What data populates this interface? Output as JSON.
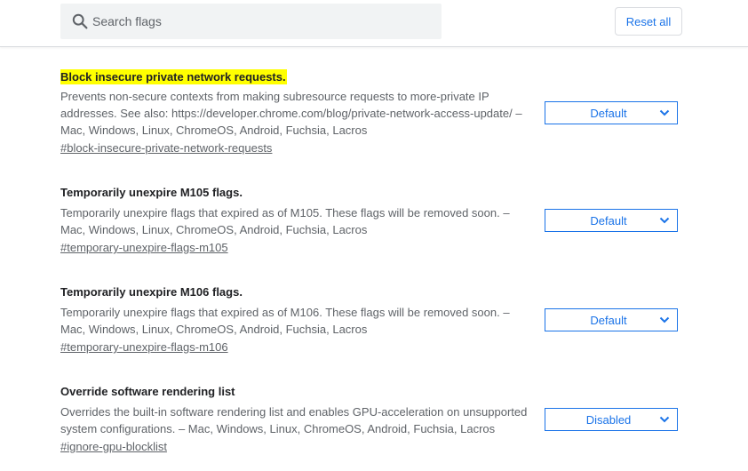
{
  "search": {
    "placeholder": "Search flags"
  },
  "toolbar": {
    "reset_label": "Reset all"
  },
  "colors": {
    "accent": "#1a73e8",
    "highlight": "#ffff00",
    "secondary_text": "#5f6368"
  },
  "flags": [
    {
      "title": "Block insecure private network requests.",
      "description": "Prevents non-secure contexts from making subresource requests to more-private IP addresses. See also: https://developer.chrome.com/blog/private-network-access-update/ – Mac, Windows, Linux, ChromeOS, Android, Fuchsia, Lacros",
      "link": "#block-insecure-private-network-requests",
      "value": "Default"
    },
    {
      "title": "Temporarily unexpire M105 flags.",
      "description": "Temporarily unexpire flags that expired as of M105. These flags will be removed soon. – Mac, Windows, Linux, ChromeOS, Android, Fuchsia, Lacros",
      "link": "#temporary-unexpire-flags-m105",
      "value": "Default"
    },
    {
      "title": "Temporarily unexpire M106 flags.",
      "description": "Temporarily unexpire flags that expired as of M106. These flags will be removed soon. – Mac, Windows, Linux, ChromeOS, Android, Fuchsia, Lacros",
      "link": "#temporary-unexpire-flags-m106",
      "value": "Default"
    },
    {
      "title": "Override software rendering list",
      "description": "Overrides the built-in software rendering list and enables GPU-acceleration on unsupported system configurations. – Mac, Windows, Linux, ChromeOS, Android, Fuchsia, Lacros",
      "link": "#ignore-gpu-blocklist",
      "value": "Disabled"
    }
  ]
}
